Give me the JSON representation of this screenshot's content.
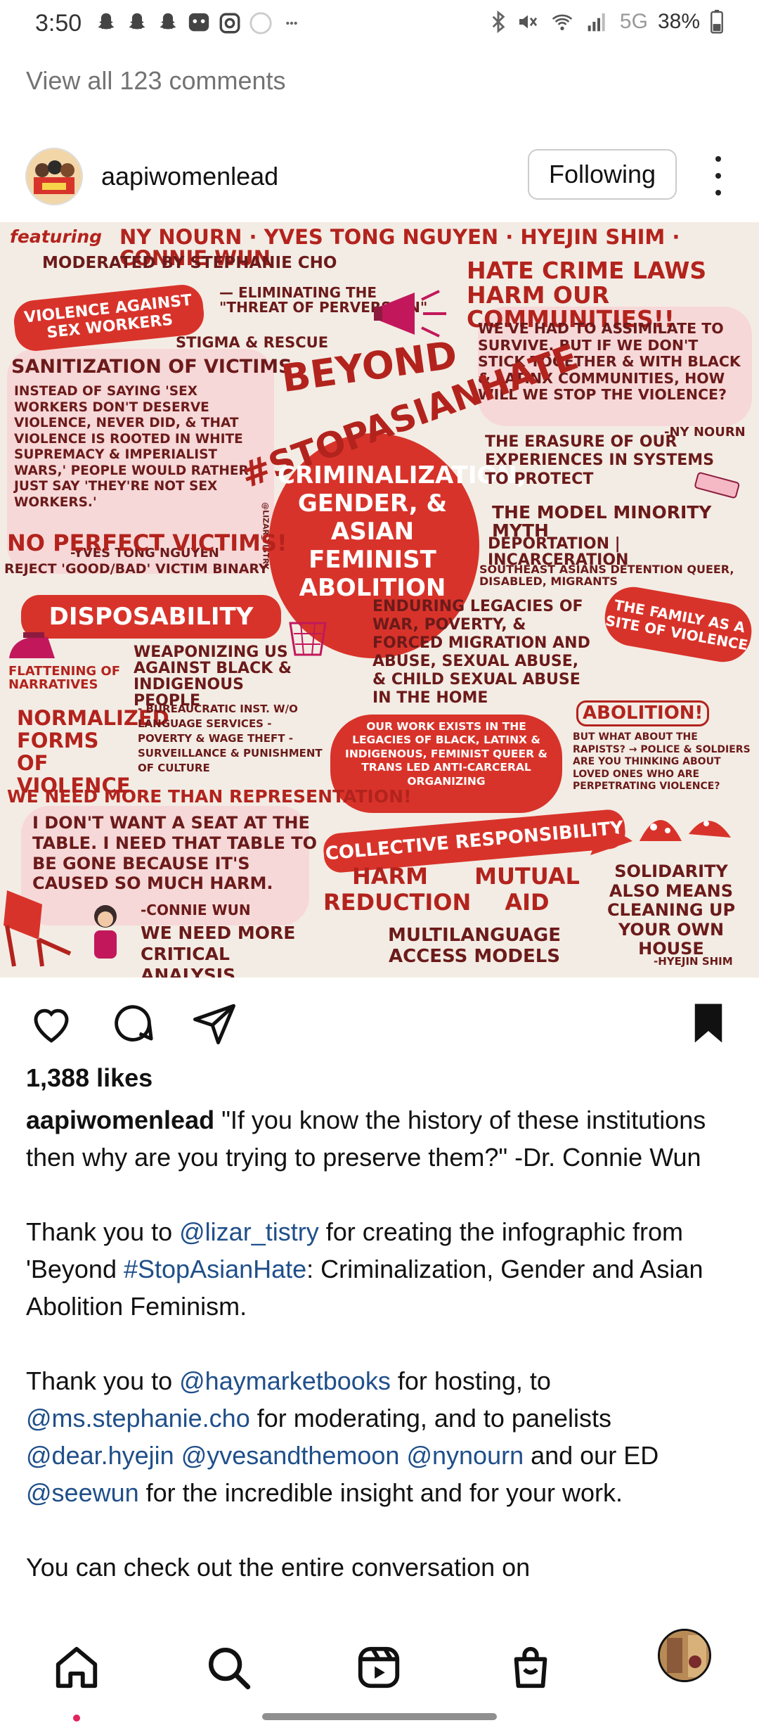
{
  "status_bar": {
    "time": "3:50",
    "battery": "38%",
    "network": "5G",
    "notification_icons": [
      "snapchat-icon",
      "snapchat-icon",
      "snapchat-icon",
      "app-icon",
      "instagram-icon",
      "circle-icon",
      "more-dots-icon"
    ]
  },
  "comments_link": "View all 123 comments",
  "post": {
    "username": "aapiwomenlead",
    "follow_label": "Following",
    "likes": "1,388 likes"
  },
  "infographic": {
    "featuring": "featuring",
    "speakers": "NY NOURN · YVES TONG NGUYEN · HYEJIN SHIM · CONNIE WUN",
    "moderated": "moderated by STEPHANIE CHO",
    "violence_banner": "VIOLENCE AGAINST SEX WORKERS",
    "eliminating": "— ELIMINATING THE \"THREAT OF PERVERSION\"",
    "stigma": "STIGMA & RESCUE",
    "sanitization": "SANITIZATION OF VICTIMS",
    "sanitization_body": "INSTEAD OF SAYING 'SEX WORKERS DON'T DESERVE VIOLENCE, NEVER DID, & THAT VIOLENCE IS ROOTED IN WHITE SUPREMACY & IMPERIALIST WARS,' PEOPLE WOULD RATHER JUST SAY 'THEY'RE NOT SEX WORKERS.'",
    "yves_credit": "-YVES TONG NGUYEN",
    "hate_crime": "HATE CRIME LAWS HARM OUR COMMUNITIES!!",
    "assimilate": "WE'VE HAD TO ASSIMILATE TO SURVIVE. BUT IF WE DON'T STICK TOGETHER & WITH BLACK & LATINX COMMUNITIES, HOW WILL WE STOP THE VIOLENCE?",
    "ny_credit": "-NY NOURN",
    "beyond": "BEYOND",
    "stopasianhate": "#STOPASIANHATE",
    "center_text": "CRIMINALIZATION, GENDER, & ASIAN FEMINIST ABOLITION",
    "artist_tag": "@LIZAR_TISTRY",
    "erasure": "THE ERASURE OF OUR EXPERIENCES IN SYSTEMS TO PROTECT",
    "model_minority": "THE MODEL MINORITY MYTH",
    "no_perfect": "NO PERFECT VICTIMS!",
    "reject": "REJECT 'GOOD/BAD' VICTIM BINARY",
    "deportation": "DEPORTATION | INCARCERATION",
    "detention": "SOUTHEAST ASIANS   DETENTION   QUEER, DISABLED, MIGRANTS",
    "disposability": "DISPOSABILITY",
    "enduring": "ENDURING LEGACIES OF WAR, POVERTY, & FORCED MIGRATION AND ABUSE, SEXUAL ABUSE, & CHILD SEXUAL ABUSE IN THE HOME",
    "family": "THE FAMILY AS A SITE OF VIOLENCE",
    "weaponizing": "WEAPONIZING US AGAINST BLACK & INDIGENOUS PEOPLE",
    "flattening": "FLATTENING OF NARRATIVES",
    "normalized": "NORMALIZED FORMS OF VIOLENCE",
    "normalized_list": "- BUREAUCRATIC INST. W/O LANGUAGE SERVICES  - POVERTY & WAGE THEFT  - SURVEILLANCE & PUNISHMENT OF CULTURE",
    "our_work": "OUR WORK EXISTS IN THE LEGACIES OF BLACK, LATINX & INDIGENOUS, FEMINIST QUEER & TRANS LED ANTI-CARCERAL ORGANIZING",
    "abolition": "ABOLITION!",
    "abolition_q": "BUT WHAT ABOUT THE RAPISTS? → POLICE & SOLDIERS  ARE YOU THINKING ABOUT LOVED ONES WHO ARE PERPETRATING VIOLENCE?",
    "more_than": "WE NEED MORE THAN REPRESENTATION!",
    "seat": "I DON'T WANT A SEAT AT THE TABLE. I NEED THAT TABLE TO BE GONE BECAUSE IT'S CAUSED SO MUCH HARM.",
    "connie_credit": "-CONNIE WUN",
    "critical": "WE NEED MORE CRITICAL ANALYSIS",
    "collective": "COLLECTIVE RESPONSIBILITY",
    "harm": "HARM REDUCTION",
    "mutual": "MUTUAL AID",
    "multilanguage": "MULTILANGUAGE ACCESS MODELS",
    "solidarity": "SOLIDARITY ALSO MEANS CLEANING UP YOUR OWN HOUSE",
    "hyejin_credit": "-HYEJIN SHIM"
  },
  "caption": {
    "username": "aapiwomenlead",
    "quote": " \"If you know the history of these institutions then why are you trying to preserve them?\" -Dr. Connie Wun",
    "p2_a": "Thank you to ",
    "p2_m1": "@lizar_tistry",
    "p2_b": " for creating the infographic from 'Beyond ",
    "p2_m2": "#StopAsianHate",
    "p2_c": ": Criminalization, Gender and Asian Abolition Feminism.",
    "p3_a": "Thank you to ",
    "p3_m1": "@haymarketbooks",
    "p3_b": " for hosting, to ",
    "p3_m2": "@ms.stephanie.cho",
    "p3_c": " for moderating, and to panelists ",
    "p3_m3": "@dear.hyejin",
    "p3_sp1": " ",
    "p3_m4": "@yvesandthemoon",
    "p3_sp2": " ",
    "p3_m5": "@nynourn",
    "p3_d": " and our ED ",
    "p3_m6": "@seewun",
    "p3_e": " for the incredible insight and for your work.",
    "p4": "You can check out the entire conversation on"
  },
  "nav": [
    "home-icon",
    "search-icon",
    "reels-icon",
    "shop-icon",
    "profile-avatar"
  ],
  "colors": {
    "accent_red": "#d8332a",
    "mention_blue": "#1f4f8a",
    "paper": "#f3ece4"
  }
}
